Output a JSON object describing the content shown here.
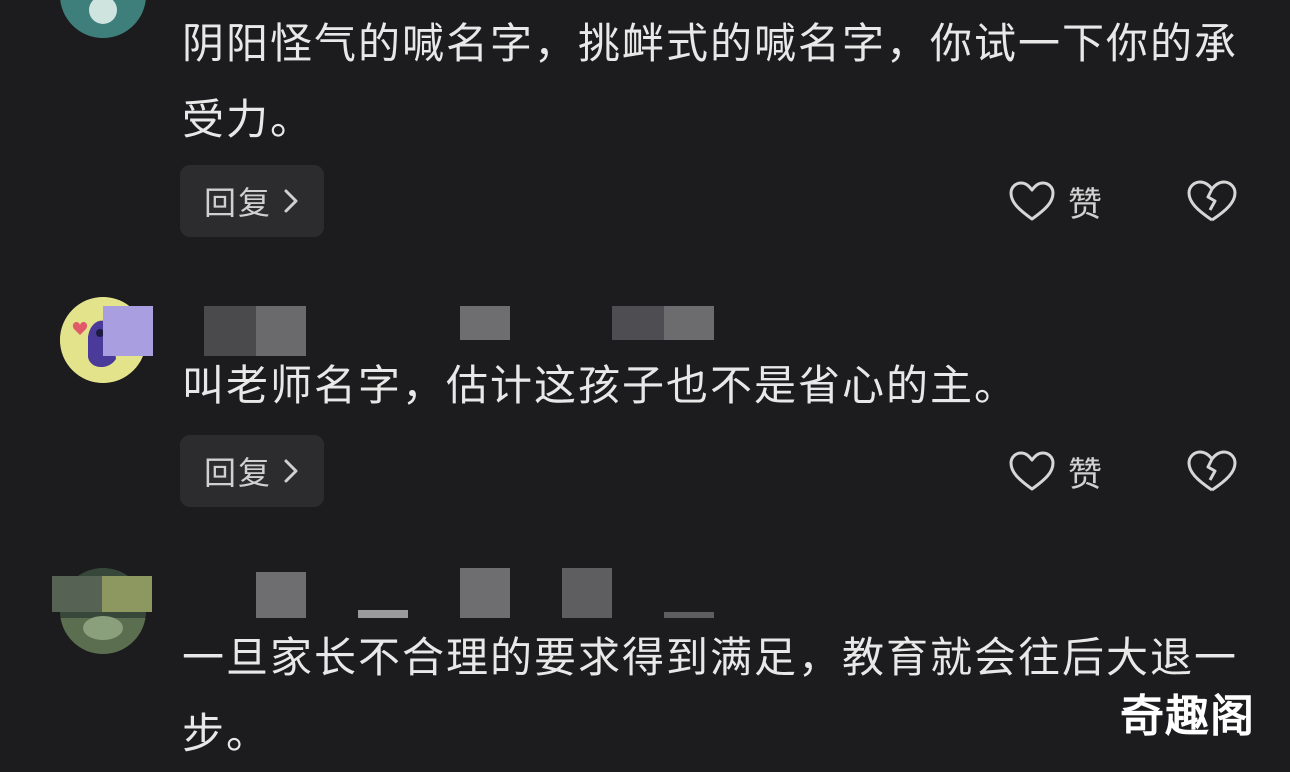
{
  "comments": [
    {
      "text": "阴阳怪气的喊名字，挑衅式的喊名字，你试一下你的承受力。",
      "reply_label": "回复",
      "like_label": "赞"
    },
    {
      "text": "叫老师名字，估计这孩子也不是省心的主。",
      "reply_label": "回复",
      "like_label": "赞"
    },
    {
      "text": "一旦家长不合理的要求得到满足，教育就会往后大退一步。"
    }
  ],
  "watermark": "奇趣阁",
  "colors": {
    "background": "#1c1c1e",
    "button_bg": "#2c2c2e",
    "text": "#e8e8e8"
  },
  "icons": [
    "heart-icon",
    "broken-heart-icon",
    "chevron-right-icon"
  ]
}
